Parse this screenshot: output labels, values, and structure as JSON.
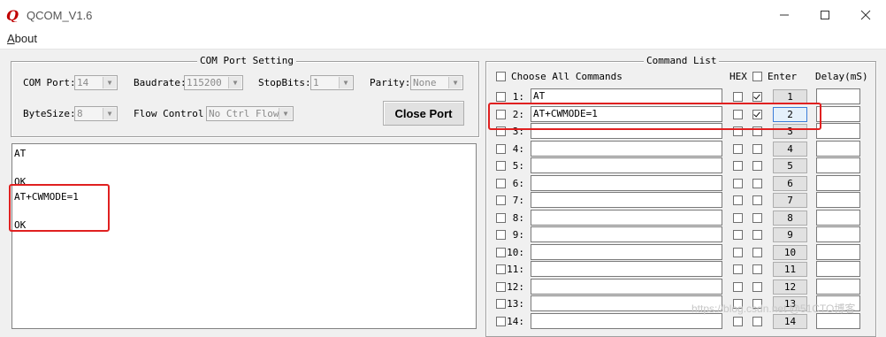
{
  "window": {
    "title": "QCOM_V1.6",
    "controls": {
      "minimize": "minimize-icon",
      "maximize": "maximize-icon",
      "close": "close-icon"
    }
  },
  "menu": {
    "about_first": "A",
    "about_rest": "bout"
  },
  "com_settings": {
    "title": "COM Port Setting",
    "com_port_label": "COM Port:",
    "com_port_value": "14",
    "baudrate_label": "Baudrate:",
    "baudrate_value": "115200",
    "stopbits_label": "StopBits:",
    "stopbits_value": "1",
    "parity_label": "Parity:",
    "parity_value": "None",
    "bytesize_label": "ByteSize:",
    "bytesize_value": "8",
    "flow_label": "Flow Control:",
    "flow_value": "No Ctrl Flow",
    "close_port_label": "Close Port"
  },
  "output": {
    "lines": [
      "AT",
      "",
      "OK",
      "AT+CWMODE=1",
      "",
      "OK"
    ]
  },
  "command_list": {
    "title": "Command List",
    "choose_all_label": "Choose All Commands",
    "hex_label": "HEX",
    "enter_label": "Enter",
    "delay_label": "Delay(mS)",
    "rows": [
      {
        "label": "1:",
        "command": "AT",
        "hex": false,
        "enter": true,
        "button": "1"
      },
      {
        "label": "2:",
        "command": "AT+CWMODE=1",
        "hex": false,
        "enter": true,
        "button": "2"
      },
      {
        "label": "3:",
        "command": "",
        "hex": false,
        "enter": false,
        "button": "3"
      },
      {
        "label": "4:",
        "command": "",
        "hex": false,
        "enter": false,
        "button": "4"
      },
      {
        "label": "5:",
        "command": "",
        "hex": false,
        "enter": false,
        "button": "5"
      },
      {
        "label": "6:",
        "command": "",
        "hex": false,
        "enter": false,
        "button": "6"
      },
      {
        "label": "7:",
        "command": "",
        "hex": false,
        "enter": false,
        "button": "7"
      },
      {
        "label": "8:",
        "command": "",
        "hex": false,
        "enter": false,
        "button": "8"
      },
      {
        "label": "9:",
        "command": "",
        "hex": false,
        "enter": false,
        "button": "9"
      },
      {
        "label": "10:",
        "command": "",
        "hex": false,
        "enter": false,
        "button": "10"
      },
      {
        "label": "11:",
        "command": "",
        "hex": false,
        "enter": false,
        "button": "11"
      },
      {
        "label": "12:",
        "command": "",
        "hex": false,
        "enter": false,
        "button": "12"
      },
      {
        "label": "13:",
        "command": "",
        "hex": false,
        "enter": false,
        "button": "13"
      },
      {
        "label": "14:",
        "command": "",
        "hex": false,
        "enter": false,
        "button": "14"
      }
    ]
  },
  "watermark": "https://blog.csdn.net @51CTO博客",
  "colors": {
    "highlight": "#e02020"
  }
}
